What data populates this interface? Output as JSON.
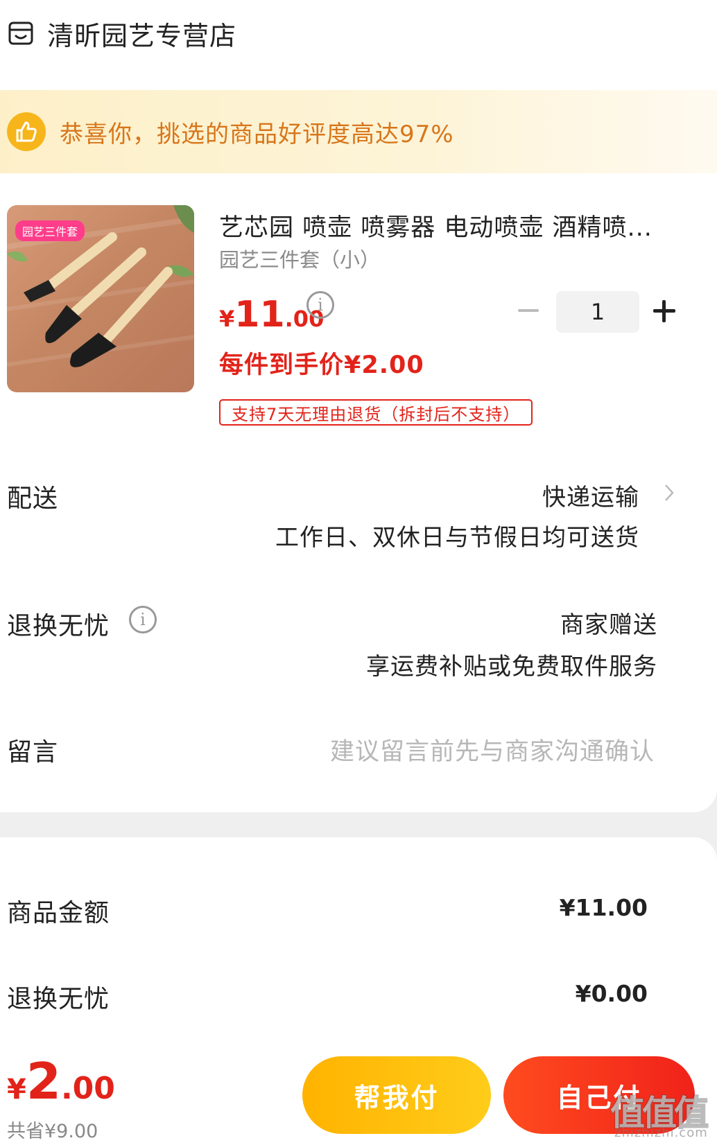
{
  "shop": {
    "name": "清昕园艺专营店",
    "icon": "shop-icon"
  },
  "praise": {
    "text": "恭喜你，挑选的商品好评度高达97%",
    "icon": "thumbs-up-icon",
    "accent": "#f7b51c"
  },
  "product": {
    "image_tag": "园艺三件套",
    "title": "艺芯园 喷壶 喷雾器 电动喷壶 酒精喷...",
    "spec": "园艺三件套（小）",
    "price": {
      "currency": "¥",
      "integer": "11",
      "decimal": ".00"
    },
    "quantity": "1",
    "deal_price": "每件到手价¥2.00",
    "return_policy": "支持7天无理由退货（拆封后不支持）"
  },
  "delivery": {
    "label": "配送",
    "method": "快递运输",
    "detail": "工作日、双休日与节假日均可送货"
  },
  "worry_free": {
    "label": "退换无忧",
    "value": "商家赠送",
    "detail": "享运费补贴或免费取件服务"
  },
  "message": {
    "label": "留言",
    "placeholder": "建议留言前先与商家沟通确认"
  },
  "summary": {
    "items": [
      {
        "label": "商品金额",
        "value": "¥11.00"
      },
      {
        "label": "退换无忧",
        "value": "¥0.00"
      }
    ]
  },
  "footer": {
    "total": {
      "currency": "¥",
      "integer": "2",
      "decimal": ".00"
    },
    "saved": "共省¥9.00",
    "help_pay": "帮我付",
    "self_pay": "自己付"
  },
  "watermark": {
    "main": "值值值",
    "sub": "zhizhizhi.com"
  },
  "colors": {
    "price_red": "#e2231a",
    "praise_orange": "#d7761b",
    "help_btn": "#ffb300",
    "self_btn": "#f0221a"
  }
}
